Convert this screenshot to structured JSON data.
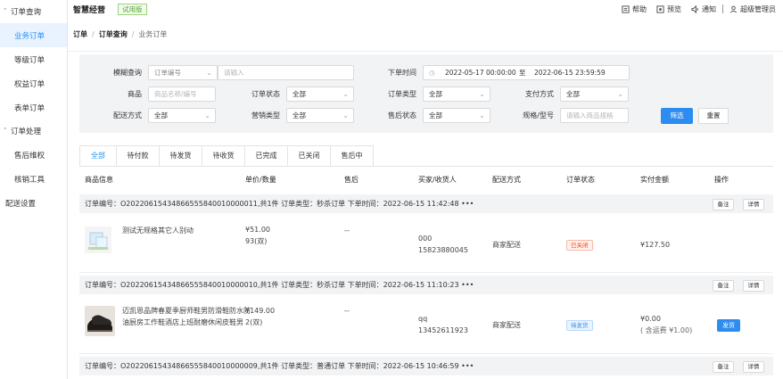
{
  "sidebar": {
    "groups": [
      {
        "label": "订单查询",
        "items": [
          "业务订单",
          "等级订单",
          "权益订单",
          "表单订单"
        ]
      },
      {
        "label": "订单处理",
        "items": [
          "售后维权",
          "核销工具"
        ]
      }
    ],
    "extra": "配送设置",
    "active": "业务订单"
  },
  "topbar": {
    "brand": "智慧经营",
    "trial": "试用版",
    "help": "帮助",
    "preview": "预览",
    "notify": "通知",
    "user": "超级管理员"
  },
  "breadcrumb": [
    "订单",
    "订单查询",
    "业务订单"
  ],
  "filters": {
    "fuzzy_label": "模糊查询",
    "fuzzy_select": "订单编号",
    "fuzzy_placeholder": "请输入",
    "time_label": "下单时间",
    "time_start": "2022-05-17 00:00:00",
    "time_to": "至",
    "time_end": "2022-06-15 23:59:59",
    "goods_label": "商品",
    "goods_placeholder": "商品名称/编号",
    "order_status_label": "订单状态",
    "order_status_value": "全部",
    "order_type_label": "订单类型",
    "order_type_value": "全部",
    "pay_label": "支付方式",
    "pay_value": "全部",
    "delivery_label": "配送方式",
    "delivery_value": "全部",
    "marketing_label": "营销类型",
    "marketing_value": "全部",
    "aftersale_label": "售后状态",
    "aftersale_value": "全部",
    "spec_label": "规格/型号",
    "spec_placeholder": "请输入商品规格",
    "filter_btn": "筛选",
    "reset_btn": "重置"
  },
  "tabs": [
    "全部",
    "待付款",
    "待发货",
    "待收货",
    "已完成",
    "已关闭",
    "售后中"
  ],
  "table_headers": {
    "goods": "商品信息",
    "price_qty": "单价/数量",
    "aftersale": "售后",
    "buyer": "买家/收货人",
    "delivery": "配送方式",
    "status": "订单状态",
    "paid": "实付金额",
    "ops": "操作"
  },
  "orders": [
    {
      "meta": "订单编号：O20220615434866555840010000011,共1件 订单类型：秒杀订单 下单时间：2022-06-15 11:42:48 •••",
      "note": "备注",
      "detail": "详情",
      "goods_name": "测试无规格其它人别动",
      "price": "¥51.00",
      "qty": "93(双)",
      "aftersale": "--",
      "buyer_name": "000",
      "buyer_phone": "15823880045",
      "delivery": "商家配送",
      "status": "已关闭",
      "paid": "¥127.50"
    },
    {
      "meta": "订单编号：O20220615434866555840010000010,共1件 订单类型：秒杀订单 下单时间：2022-06-15 11:10:23 •••",
      "note": "备注",
      "detail": "详情",
      "goods_name_1": "迈凯恩品牌春夏季厨师鞋男防滑鞋防水防",
      "goods_name_2": "油厨房工作鞋酒店上班耐磨休闲皮鞋男",
      "price": "¥149.00",
      "qty": "2(双)",
      "aftersale": "--",
      "buyer_name": "qq",
      "buyer_phone": "13452611923",
      "delivery": "商家配送",
      "status": "待发货",
      "paid": "¥0.00",
      "paid_note": "( 含运费 ¥1.00)",
      "ship_btn": "发货"
    },
    {
      "meta": "订单编号：O20220615434866555840010000009,共1件 订单类型：普通订单 下单时间：2022-06-15 10:46:59 •••",
      "note": "备注",
      "detail": "详情"
    }
  ],
  "colors": {
    "primary": "#2d8cf0",
    "active_bg": "#e9f2ff",
    "panel_bg": "#f2f3f5",
    "trial_green": "#55a832",
    "closed_red": "#ed4014"
  }
}
